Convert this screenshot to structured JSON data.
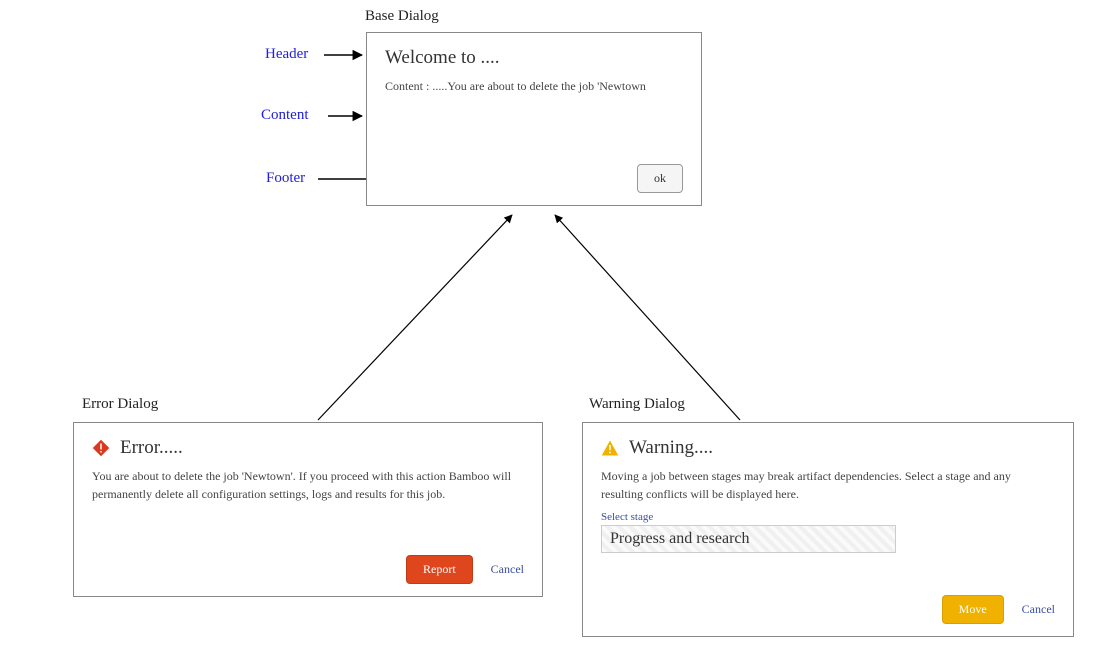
{
  "labels": {
    "base_title": "Base Dialog",
    "header": "Header",
    "content": "Content",
    "footer": "Footer",
    "error_title": "Error Dialog",
    "warning_title": "Warning Dialog"
  },
  "base": {
    "header": "Welcome to ....",
    "content": "Content : .....You are about to delete the job 'Newtown",
    "ok": "ok"
  },
  "error": {
    "header": "Error.....",
    "content": "You are about to delete the job 'Newtown'. If you proceed with this action Bamboo will permanently delete all configuration settings, logs and results for this job.",
    "report": "Report",
    "cancel": "Cancel"
  },
  "warning": {
    "header": "Warning....",
    "content": "Moving a job between stages may break artifact dependencies. Select a stage and any resulting conflicts will be displayed here.",
    "field_label": "Select stage",
    "field_value": "Progress and research",
    "move": "Move",
    "cancel": "Cancel"
  }
}
